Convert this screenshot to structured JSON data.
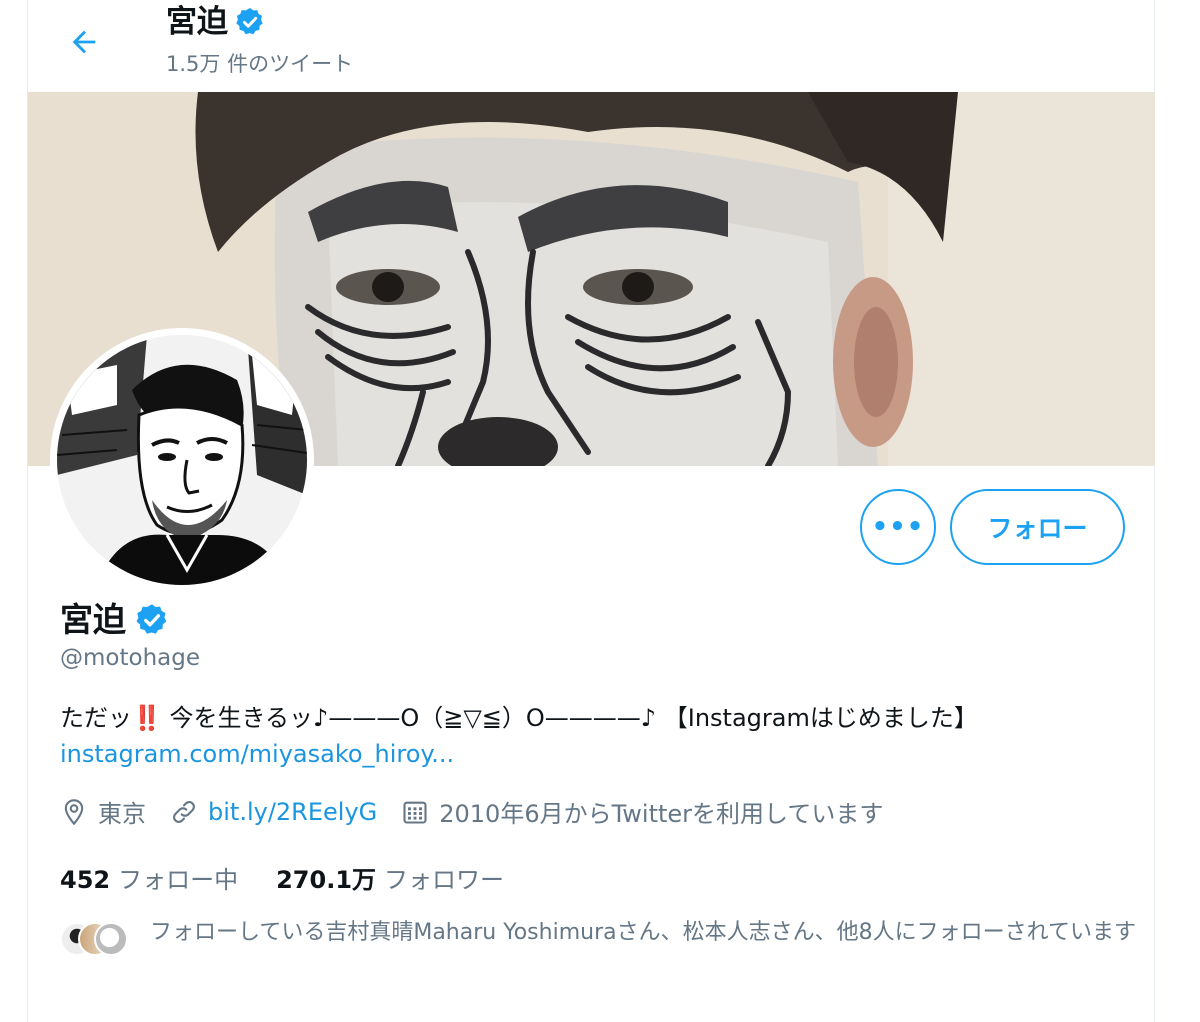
{
  "header": {
    "name": "宮迫",
    "tweet_count": "1.5万 件のツイート"
  },
  "actions": {
    "more_label": "•••",
    "follow_label": "フォロー"
  },
  "profile": {
    "name": "宮迫",
    "handle": "@motohage",
    "bio_text": "ただッ",
    "bio_emoji": "‼️",
    "bio_rest": " 今を生きるッ♪———O（≧▽≦）O————♪ 【Instagramはじめました】",
    "bio_link": "instagram.com/miyasako_hiroy...",
    "location": "東京",
    "website": "bit.ly/2REelyG",
    "joined": "2010年6月からTwitterを利用しています"
  },
  "stats": {
    "following_count": "452",
    "following_label": "フォロー中",
    "followers_count": "270.1万",
    "followers_label": "フォロワー"
  },
  "followed_by": {
    "text": "フォローしている吉村真晴Maharu Yoshimuraさん、松本人志さん、他8人にフォローされています"
  },
  "colors": {
    "accent": "#1da1f2",
    "link": "#1b95e0",
    "secondary_text": "#657786",
    "primary_text": "#0f1419"
  },
  "icons": [
    "back-arrow-icon",
    "verified-badge-icon",
    "location-icon",
    "link-icon",
    "calendar-icon"
  ]
}
